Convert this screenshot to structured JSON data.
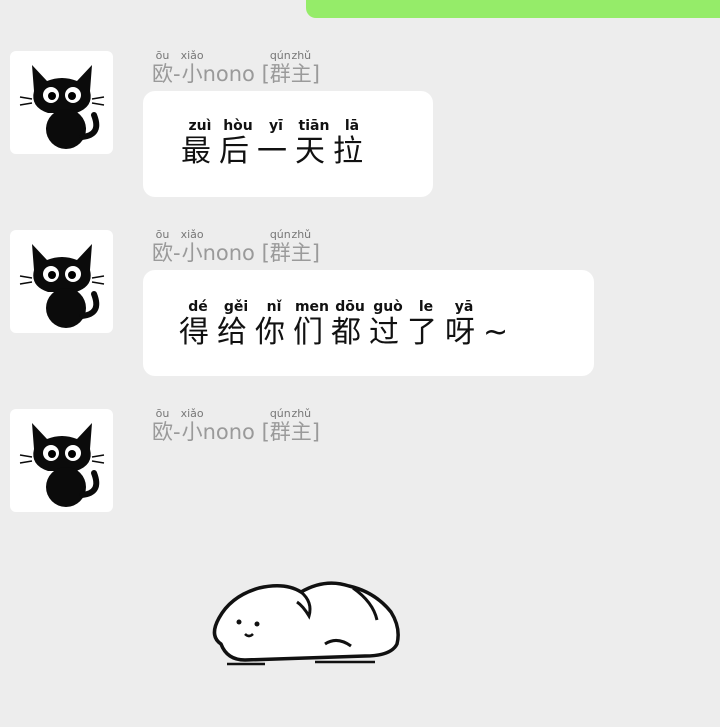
{
  "sender": {
    "name_prefix": [
      {
        "char": "欧",
        "py": "ōu"
      },
      {
        "char": "-",
        "py": ""
      },
      {
        "char": "小",
        "py": "xiǎo"
      }
    ],
    "name_latin": "nono",
    "bracket_open": "[",
    "role": [
      {
        "char": "群",
        "py": "qún"
      },
      {
        "char": "主",
        "py": "zhǔ"
      }
    ],
    "bracket_close": "]"
  },
  "messages": [
    {
      "chars": [
        {
          "char": "最",
          "py": "zuì"
        },
        {
          "char": "后",
          "py": "hòu"
        },
        {
          "char": "一",
          "py": "yī"
        },
        {
          "char": "天",
          "py": "tiān"
        },
        {
          "char": "拉",
          "py": "lā"
        }
      ]
    },
    {
      "chars": [
        {
          "char": "得",
          "py": "dé"
        },
        {
          "char": "给",
          "py": "gěi"
        },
        {
          "char": "你",
          "py": "nǐ"
        },
        {
          "char": "们",
          "py": "men"
        },
        {
          "char": "都",
          "py": "dōu"
        },
        {
          "char": "过",
          "py": "guò"
        },
        {
          "char": "了",
          "py": "le"
        },
        {
          "char": "呀",
          "py": "yā"
        },
        {
          "char": "~",
          "py": ""
        }
      ]
    }
  ],
  "colors": {
    "own_bubble": "#95ec69",
    "background": "#ededed",
    "bubble": "#ffffff"
  },
  "icons": {
    "avatar": "black-cat-icon",
    "sticker": "sleeping-puppy-sticker"
  }
}
